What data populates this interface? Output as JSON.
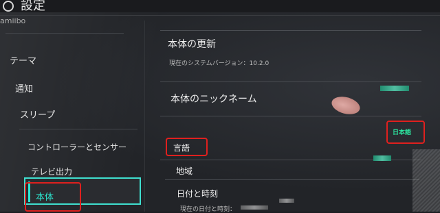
{
  "header": {
    "title": "設定"
  },
  "sidebar": {
    "partial_top": "amiibo",
    "items": [
      {
        "label": "テーマ"
      },
      {
        "label": "通知"
      },
      {
        "label": "スリープ"
      },
      {
        "label": "コントローラーとセンサー"
      },
      {
        "label": "テレビ出力"
      },
      {
        "label": "本体"
      }
    ],
    "selected": "本体"
  },
  "main": {
    "update": {
      "title": "本体の更新",
      "version_label": "現在のシステムバージョン：10.2.0"
    },
    "nickname": {
      "title": "本体のニックネーム"
    },
    "language": {
      "title": "言語",
      "value": "日本語"
    },
    "region": {
      "title": "地域"
    },
    "datetime": {
      "title": "日付と時刻",
      "sub": "現在の日付と時刻："
    }
  },
  "colors": {
    "accent": "#2ce6d0",
    "highlight_red": "#e0201e"
  }
}
